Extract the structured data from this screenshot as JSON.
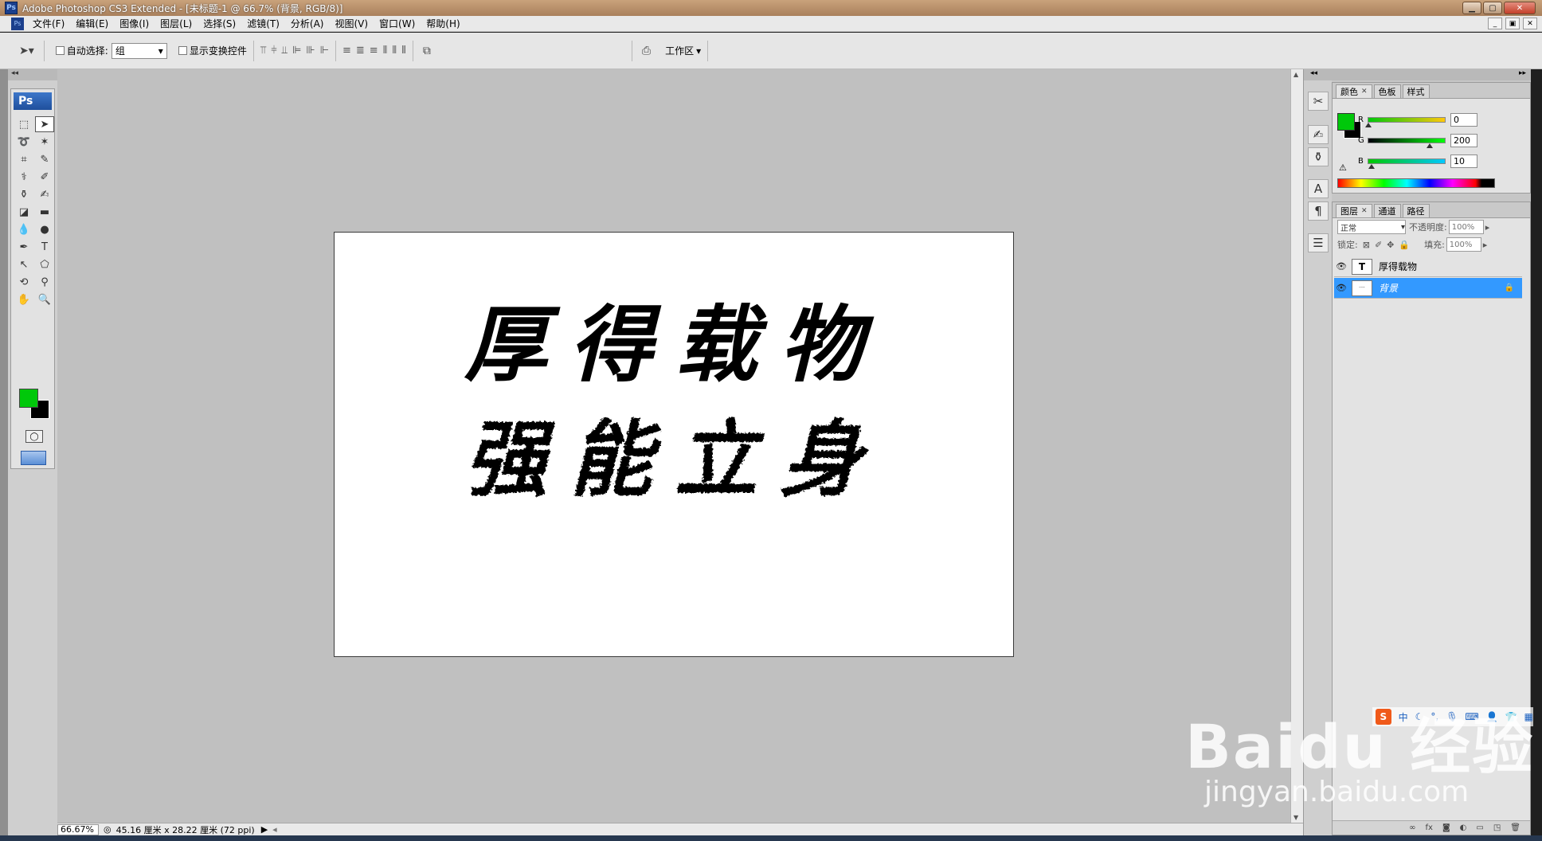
{
  "titlebar": {
    "title": "Adobe Photoshop CS3 Extended - [未标题-1 @ 66.7% (背景, RGB/8)]",
    "app_icon": "Ps"
  },
  "menubar": {
    "ps_icon": "Ps",
    "items": [
      "文件(F)",
      "编辑(E)",
      "图像(I)",
      "图层(L)",
      "选择(S)",
      "滤镜(T)",
      "分析(A)",
      "视图(V)",
      "窗口(W)",
      "帮助(H)"
    ]
  },
  "options": {
    "auto_select_label": "自动选择:",
    "auto_select_value": "组",
    "show_transform_label": "显示变换控件",
    "workspace_label": "工作区"
  },
  "toolbox": {
    "logo": "Ps",
    "tools": [
      "marquee-icon",
      "move-icon",
      "lasso-icon",
      "magic-wand-icon",
      "crop-icon",
      "slice-icon",
      "healing-icon",
      "brush-icon",
      "clone-stamp-icon",
      "history-brush-icon",
      "eraser-icon",
      "gradient-icon",
      "blur-icon",
      "dodge-icon",
      "pen-icon",
      "type-icon",
      "path-select-icon",
      "shape-icon",
      "3d-rotate-icon",
      "eyedropper-icon",
      "hand-icon",
      "zoom-icon"
    ],
    "foreground_color": "#00c80a",
    "background_color": "#000000"
  },
  "document": {
    "line1": "厚得载物",
    "line2": "强能立身"
  },
  "statusbar": {
    "zoom": "66.67%",
    "doc_info": "45.16 厘米 x 28.22 厘米 (72 ppi)"
  },
  "color_panel": {
    "tabs": [
      "颜色",
      "色板",
      "样式"
    ],
    "channels": [
      {
        "label": "R",
        "value": "0",
        "level": 0.0
      },
      {
        "label": "G",
        "value": "200",
        "level": 0.784
      },
      {
        "label": "B",
        "value": "10",
        "level": 0.039
      }
    ]
  },
  "layers_panel": {
    "tabs": [
      "图层",
      "通道",
      "路径"
    ],
    "blend_mode": "正常",
    "opacity_label": "不透明度:",
    "opacity_value": "100%",
    "lock_label": "锁定:",
    "fill_label": "填充:",
    "fill_value": "100%",
    "layers": [
      {
        "name": "厚得载物",
        "type": "T",
        "selected": false
      },
      {
        "name": "背景",
        "type": "image",
        "selected": true
      }
    ]
  },
  "ime": {
    "logo": "S",
    "mode": "中"
  },
  "watermark": {
    "main": "Baidu 经验",
    "sub": "jingyan.baidu.com"
  }
}
